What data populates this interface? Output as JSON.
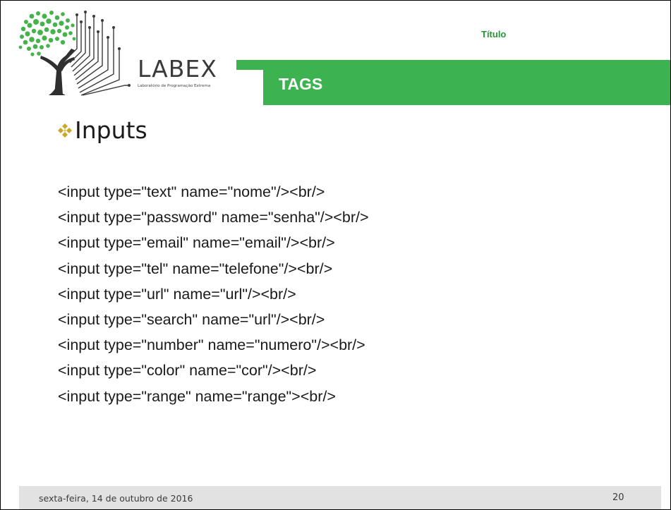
{
  "header": {
    "logo_text": "LABEX",
    "logo_subtitle": "Laboratório de Programação Extrema",
    "title_label": "Título",
    "section_label": "TAGS"
  },
  "content": {
    "heading": "Inputs",
    "bullet_icon": "diamond-bullet-icon",
    "code_lines": [
      "<input type=\"text\" name=\"nome\"/><br/>",
      "<input type=\"password\" name=\"senha\"/><br/>",
      "<input type=\"email\" name=\"email\"/><br/>",
      "<input type=\"tel\" name=\"telefone\"/><br/>",
      "<input type=\"url\" name=\"url\"/><br/>",
      "<input type=\"search\" name=\"url\"/><br/>",
      "<input type=\"number\" name=\"numero\"/><br/>",
      "<input type=\"color\" name=\"cor\"/><br/>",
      "<input type=\"range\" name=\"range\"><br/>"
    ]
  },
  "footer": {
    "date": "sexta-feira, 14 de outubro de 2016",
    "page_number": "20"
  },
  "colors": {
    "accent_green": "#3db251",
    "title_green": "#1f9a34",
    "footer_gray": "#e2e2e2",
    "text_dark": "#1a1a1a"
  }
}
